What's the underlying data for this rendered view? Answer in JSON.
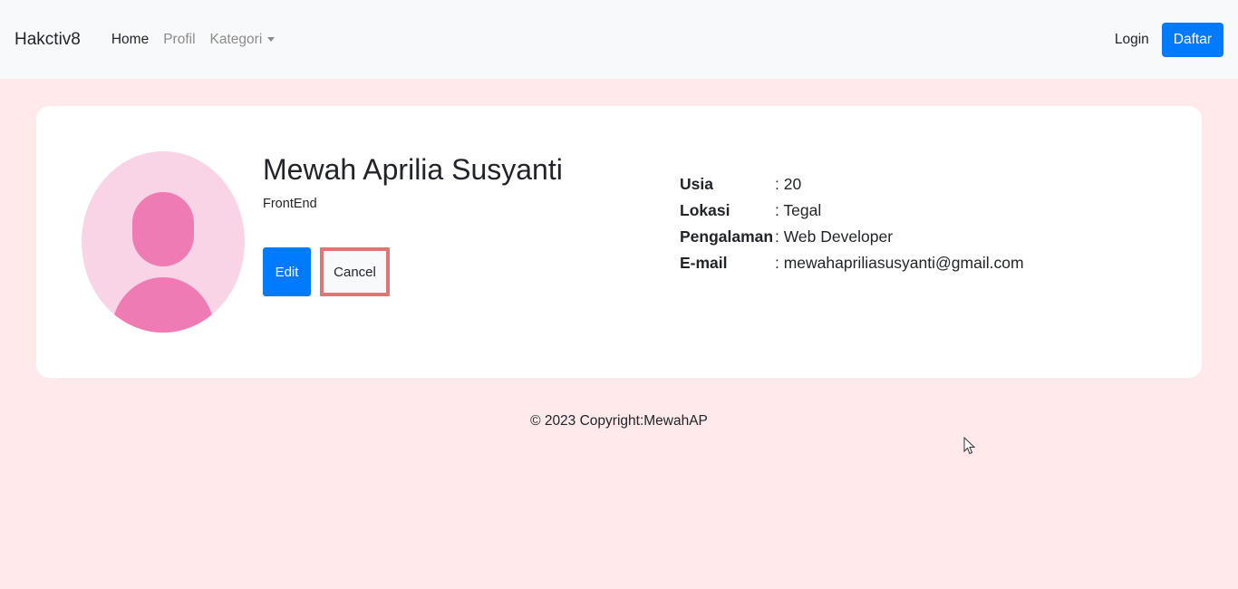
{
  "navbar": {
    "brand": "Hakctiv8",
    "links": [
      {
        "label": "Home",
        "active": true
      },
      {
        "label": "Profil",
        "active": false
      },
      {
        "label": "Kategori",
        "active": false,
        "dropdown": true
      }
    ],
    "login_label": "Login",
    "register_label": "Daftar"
  },
  "profile": {
    "name": "Mewah Aprilia Susyanti",
    "role": "FrontEnd",
    "edit_label": "Edit",
    "cancel_label": "Cancel",
    "details": [
      {
        "label": "Usia",
        "value": ": 20"
      },
      {
        "label": "Lokasi",
        "value": ": Tegal"
      },
      {
        "label": "Pengalaman",
        "value": ": Web Developer"
      },
      {
        "label": "E-mail",
        "value": ": mewahapriliasusyanti@gmail.com"
      }
    ]
  },
  "footer": {
    "text": "© 2023 Copyright:MewahAP"
  },
  "colors": {
    "page_bg": "#ffe9ea",
    "accent": "#007bff",
    "avatar_bg": "#f8d4e6",
    "avatar_fg": "#ee7bb3",
    "highlight_border": "#e07575"
  }
}
